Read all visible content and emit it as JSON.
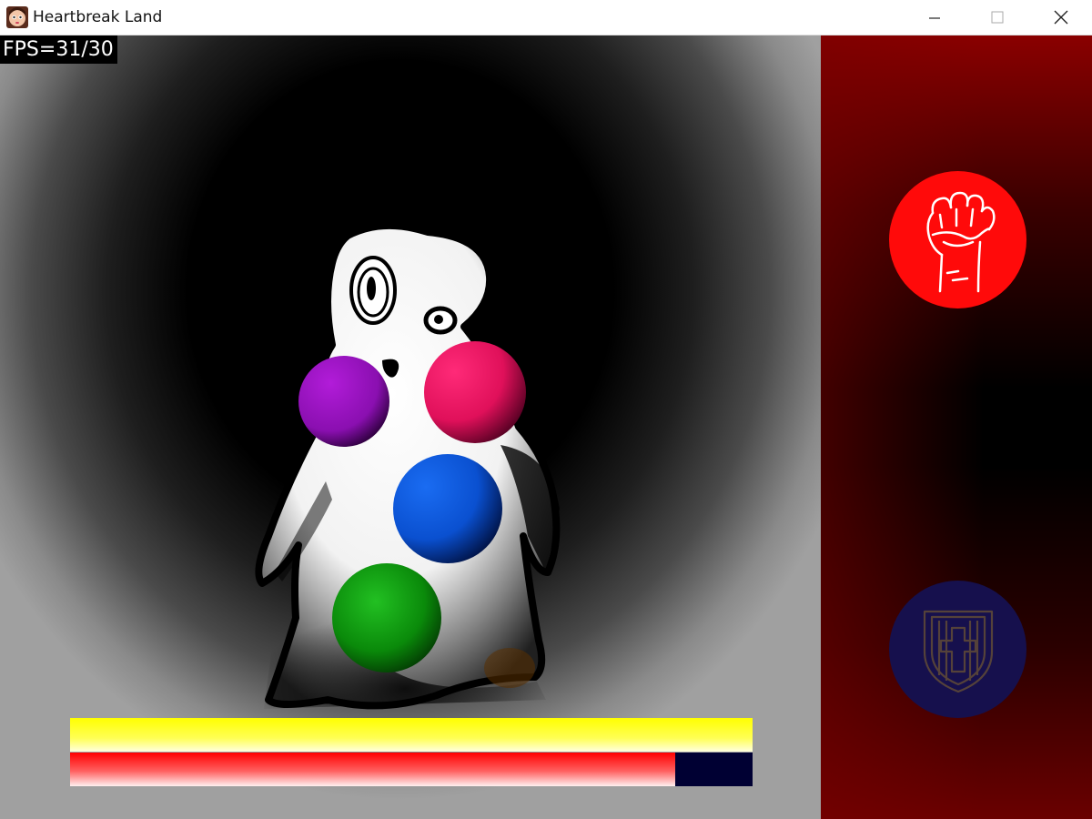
{
  "window": {
    "title": "Heartbreak Land",
    "icon": "doll-face-icon"
  },
  "hud": {
    "fps_text": "FPS=31/30"
  },
  "enemy": {
    "name_icon": "polka-dot-ghost",
    "spots": [
      "purple",
      "pink",
      "blue",
      "green",
      "orange"
    ]
  },
  "bars": {
    "timing_fill": 1.0,
    "health_fill": 0.887
  },
  "actions": {
    "attack_icon": "fist-icon",
    "defend_icon": "shield-icon",
    "attack_color": "#ff0a0a",
    "defend_color": "#16104d"
  },
  "colors": {
    "accent_red": "#ff0000",
    "bar_yellow": "#ffff00",
    "side_panel": "#8a0000"
  }
}
